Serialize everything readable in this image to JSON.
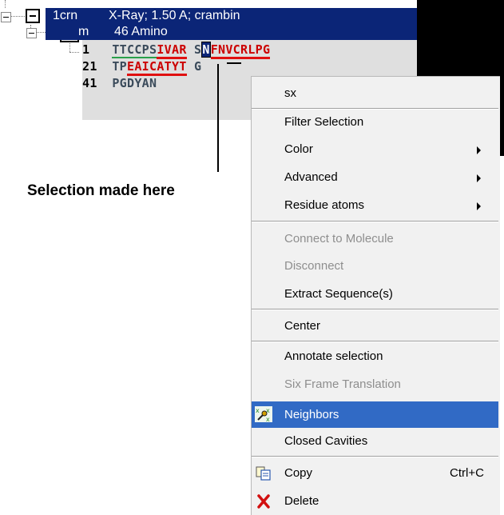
{
  "tree": {
    "row1": {
      "id": "1crn",
      "desc": "X-Ray; 1.50 A; crambin"
    },
    "row2": {
      "id": "m",
      "desc": "46 Amino"
    },
    "sequence": [
      {
        "num": "1",
        "pre": "TTCCPS",
        "sel": "IVAR",
        "gap": " S",
        "boxed": "N",
        "post": "FNVCRLPG"
      },
      {
        "num": "21",
        "pre": "TP",
        "sel": "EAICATYT",
        "gap": " G",
        "post": ""
      },
      {
        "num": "41",
        "pre": "PGDYAN"
      }
    ]
  },
  "annotation": {
    "label": "Selection made here"
  },
  "menu": {
    "items": [
      {
        "key": "sx",
        "label": "sx",
        "enabled": true
      },
      {
        "key": "filter",
        "label": "Filter Selection",
        "enabled": true
      },
      {
        "key": "color",
        "label": "Color",
        "enabled": true,
        "submenu": true
      },
      {
        "key": "advanced",
        "label": "Advanced",
        "enabled": true,
        "submenu": true
      },
      {
        "key": "residue_atoms",
        "label": "Residue atoms",
        "enabled": true,
        "submenu": true
      },
      {
        "key": "connect",
        "label": "Connect to Molecule",
        "enabled": false
      },
      {
        "key": "disconnect",
        "label": "Disconnect",
        "enabled": false
      },
      {
        "key": "extract",
        "label": "Extract Sequence(s)",
        "enabled": true
      },
      {
        "key": "center",
        "label": "Center",
        "enabled": true
      },
      {
        "key": "annotate",
        "label": "Annotate selection",
        "enabled": true
      },
      {
        "key": "six_frame",
        "label": "Six Frame Translation",
        "enabled": false
      },
      {
        "key": "neighbors",
        "label": "Neighbors",
        "enabled": true,
        "highlighted": true,
        "icon": "neighbors-icon"
      },
      {
        "key": "closed_cavities",
        "label": "Closed Cavities",
        "enabled": true
      },
      {
        "key": "copy",
        "label": "Copy",
        "shortcut": "Ctrl+C",
        "enabled": true,
        "icon": "copy-icon"
      },
      {
        "key": "delete",
        "label": "Delete",
        "enabled": true,
        "icon": "delete-icon"
      }
    ]
  },
  "colors": {
    "selection_navy": "#0b2577",
    "menu_highlight": "#316ac5",
    "menu_bg": "#f1f1f1",
    "sequence_bg": "#dfdfdf",
    "underline_red": "#e01010",
    "underline_green": "#2aa04a"
  }
}
